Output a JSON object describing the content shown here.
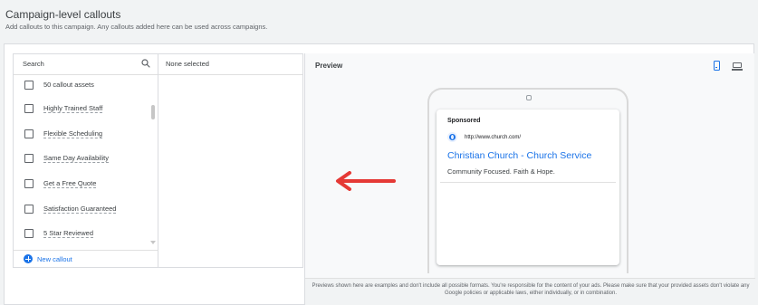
{
  "header": {
    "title": "Campaign-level callouts",
    "subtitle": "Add callouts to this campaign. Any callouts added here can be used across campaigns."
  },
  "list": {
    "search_label": "Search",
    "select_all_label": "50 callout assets",
    "items": [
      {
        "label": "Highly Trained Staff"
      },
      {
        "label": "Flexible Scheduling"
      },
      {
        "label": "Same Day Availability"
      },
      {
        "label": "Get a Free Quote"
      },
      {
        "label": "Satisfaction Guaranteed"
      },
      {
        "label": "5 Star Reviewed"
      }
    ],
    "new_callout_label": "New callout"
  },
  "selected": {
    "label": "None selected"
  },
  "preview": {
    "title": "Preview",
    "device_selected": "mobile",
    "ad": {
      "sponsored_label": "Sponsored",
      "url": "http://www.church.com/",
      "headline": "Christian Church - Church Service",
      "description": "Community Focused. Faith & Hope."
    },
    "disclaimer": "Previews shown here are examples and don't include all possible formats. You're responsible for the content of your ads. Please make sure that your provided assets don't violate any Google policies or applicable laws, either individually, or in combination."
  },
  "colors": {
    "accent": "#1a73e8",
    "annotation_arrow": "#e53935"
  }
}
